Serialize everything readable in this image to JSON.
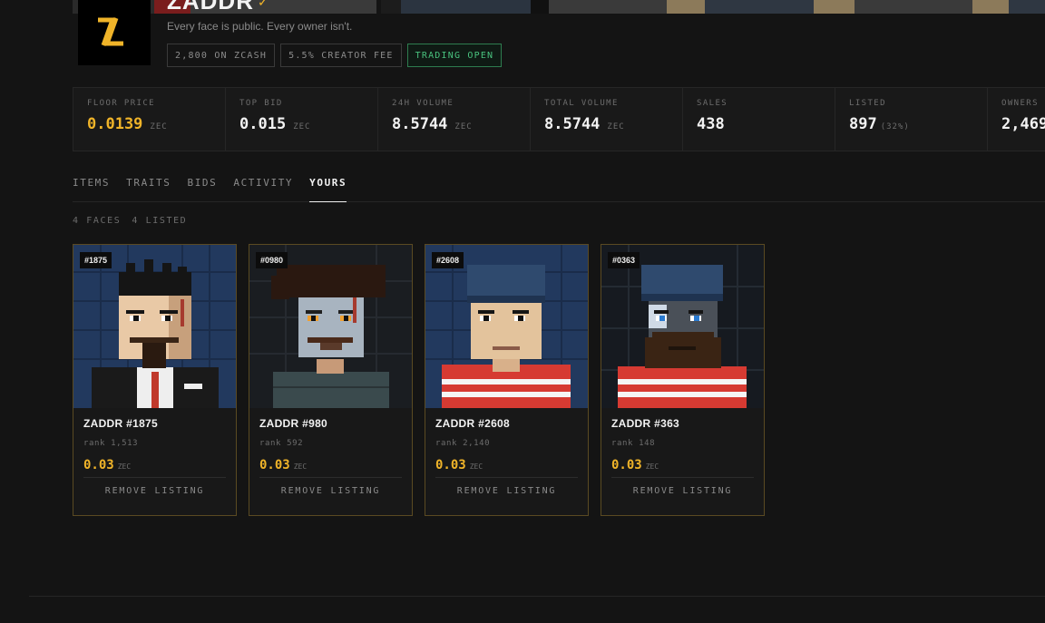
{
  "collection": {
    "title": "ZADDR",
    "verified_icon": "verified-check-icon",
    "tagline": "Every face is public. Every owner isn't.",
    "pills": [
      "2,800 ON ZCASH",
      "5.5% CREATOR FEE",
      "TRADING OPEN"
    ]
  },
  "stats": [
    {
      "label": "FLOOR PRICE",
      "value": "0.0139",
      "unit": "ZEC"
    },
    {
      "label": "TOP BID",
      "value": "0.015",
      "unit": "ZEC"
    },
    {
      "label": "24H VOLUME",
      "value": "8.5744",
      "unit": "ZEC"
    },
    {
      "label": "TOTAL VOLUME",
      "value": "8.5744",
      "unit": "ZEC"
    },
    {
      "label": "SALES",
      "value": "438",
      "unit": ""
    },
    {
      "label": "LISTED",
      "value": "897",
      "unit": "(32%)"
    },
    {
      "label": "OWNERS",
      "value": "2,469",
      "unit": ""
    }
  ],
  "tabs": [
    "ITEMS",
    "TRAITS",
    "BIDS",
    "ACTIVITY",
    "YOURS"
  ],
  "active_tab": "YOURS",
  "summary": {
    "faces": "4 FACES",
    "listed": "4 LISTED"
  },
  "cards": [
    {
      "tag": "#1875",
      "name": "ZADDR #1875",
      "rank": "rank 1,513",
      "price": "0.03",
      "unit": "ZEC",
      "action": "REMOVE LISTING"
    },
    {
      "tag": "#0980",
      "name": "ZADDR #980",
      "rank": "rank 592",
      "price": "0.03",
      "unit": "ZEC",
      "action": "REMOVE LISTING"
    },
    {
      "tag": "#2608",
      "name": "ZADDR #2608",
      "rank": "rank 2,140",
      "price": "0.03",
      "unit": "ZEC",
      "action": "REMOVE LISTING"
    },
    {
      "tag": "#0363",
      "name": "ZADDR #363",
      "rank": "rank 148",
      "price": "0.03",
      "unit": "ZEC",
      "action": "REMOVE LISTING"
    }
  ],
  "colors": {
    "accent": "#f0b429",
    "open": "#49c27e",
    "border_card": "#5a4a22"
  }
}
